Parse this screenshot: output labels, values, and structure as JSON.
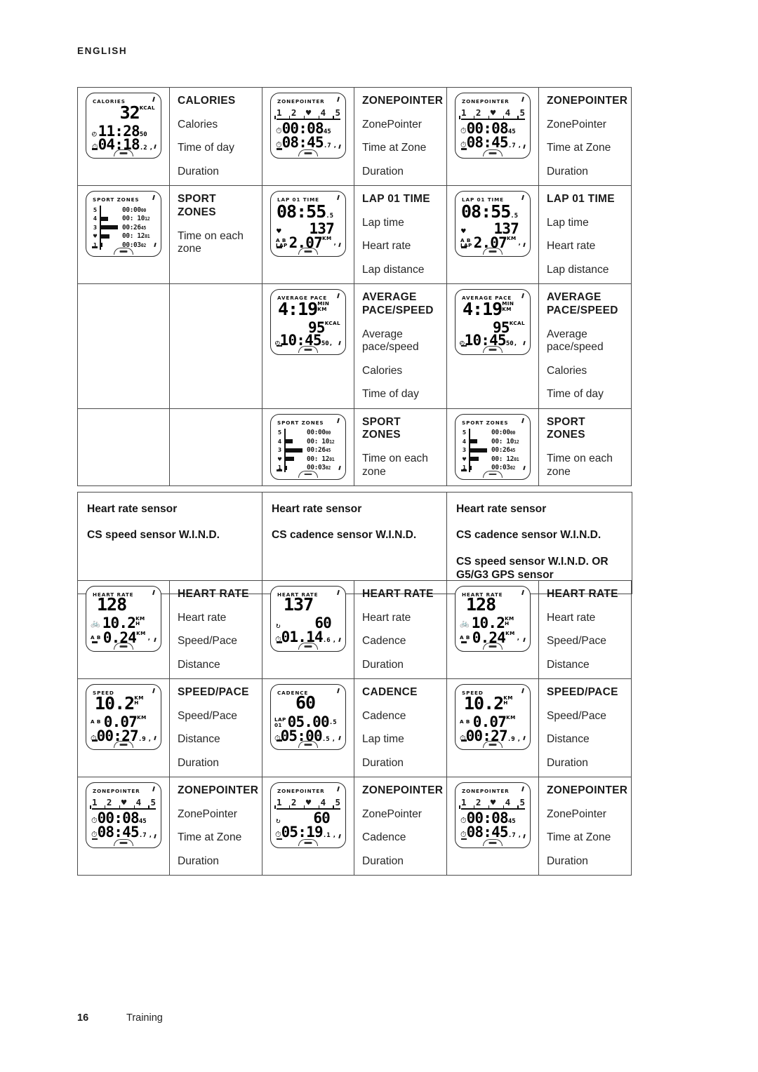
{
  "header": {
    "language": "ENGLISH"
  },
  "footer": {
    "page_number": "16",
    "section": "Training"
  },
  "displays": {
    "calories": {
      "screen_title": "CALORIES",
      "value": "32",
      "value_unit": "KCAL",
      "time_of_day": "11:28",
      "time_of_day_sub": "50",
      "duration": "04:18",
      "duration_sub": ".2"
    },
    "zonepointer": {
      "screen_title": "ZONEPOINTER",
      "zones": [
        "1",
        "2",
        "♥",
        "4",
        "5"
      ],
      "time_at_zone": "00:08",
      "time_at_zone_sub": "45",
      "duration": "08:45",
      "duration_sub": ".7"
    },
    "sport_zones": {
      "screen_title": "SPORT ZONES",
      "rows": [
        {
          "label": "5",
          "value": "00:00",
          "sub": "00",
          "bar": 2
        },
        {
          "label": "4",
          "value": "00: 10",
          "sub": "12",
          "bar": 12
        },
        {
          "label": "3",
          "value": "00:26",
          "sub": "45",
          "bar": 24
        },
        {
          "label": "♥",
          "value": "00: 12",
          "sub": "01",
          "bar": 13
        },
        {
          "label": "1",
          "value": "00:03",
          "sub": "02",
          "bar": 4
        }
      ]
    },
    "lap_01_time": {
      "screen_title": "LAP 01 TIME",
      "lap_time": "08:55",
      "lap_time_sub": ".5",
      "heart_rate": "137",
      "lap_distance": "2.07",
      "lap_distance_unit": "KM"
    },
    "average_pace": {
      "screen_title": "AVERAGE PACE",
      "pace": "4:19",
      "pace_unit": "MIN\nKM",
      "calories": "95",
      "calories_unit": "KCAL",
      "time_of_day": "10:45",
      "time_of_day_sub": "50"
    },
    "heart_rate_bike": {
      "screen_title": "HEART RATE",
      "heart_rate": "128",
      "speed": "10.2",
      "speed_unit": "KM\nH",
      "distance": "0.24",
      "distance_unit": "KM"
    },
    "heart_rate_cadence": {
      "screen_title": "HEART RATE",
      "heart_rate": "137",
      "cadence": "60",
      "duration": "01.14",
      "duration_sub": ".6"
    },
    "speed_pace": {
      "screen_title": "SPEED",
      "speed": "10.2",
      "speed_unit": "KM\nH",
      "distance": "0.07",
      "distance_unit": "KM",
      "duration": "00:27",
      "duration_sub": ".9"
    },
    "cadence": {
      "screen_title": "CADENCE",
      "cadence": "60",
      "lap_label": "LAP\n01",
      "lap_time": "05.00",
      "lap_time_sub": ".5",
      "duration": "05:00",
      "duration_sub": ".5"
    },
    "zonepointer_cadence": {
      "screen_title": "ZONEPOINTER",
      "zones": [
        "1",
        "2",
        "♥",
        "4",
        "5"
      ],
      "cadence": "60",
      "duration": "05:19",
      "duration_sub": ".1"
    }
  },
  "table_top": {
    "rows": [
      {
        "col1_heading": "CALORIES",
        "col1_items": [
          "Calories",
          "Time of day",
          "Duration"
        ],
        "col2_heading": "ZONEPOINTER",
        "col2_items": [
          "ZonePointer",
          "Time at Zone",
          "Duration"
        ],
        "col3_heading": "ZONEPOINTER",
        "col3_items": [
          "ZonePointer",
          "Time at Zone",
          "Duration"
        ]
      },
      {
        "col1_heading": "SPORT ZONES",
        "col1_items": [
          "Time on each zone"
        ],
        "col2_heading": "LAP 01 TIME",
        "col2_items": [
          "Lap time",
          "Heart rate",
          "Lap distance"
        ],
        "col3_heading": "LAP 01 TIME",
        "col3_items": [
          "Lap time",
          "Heart rate",
          "Lap distance"
        ]
      },
      {
        "col1_heading": "",
        "col1_items": [],
        "col2_heading": "AVERAGE\nPACE/SPEED",
        "col2_items": [
          "Average pace/speed",
          "Calories",
          "Time of day"
        ],
        "col3_heading": "AVERAGE\nPACE/SPEED",
        "col3_items": [
          "Average pace/speed",
          "Calories",
          "Time of day"
        ]
      },
      {
        "col1_heading": "",
        "col1_items": [],
        "col2_heading": "SPORT ZONES",
        "col2_items": [
          "Time on each zone"
        ],
        "col3_heading": "SPORT ZONES",
        "col3_items": [
          "Time on each zone"
        ]
      }
    ]
  },
  "table_sensors": {
    "col1": [
      "Heart rate sensor",
      "CS speed sensor W.I.N.D."
    ],
    "col2": [
      "Heart rate sensor",
      "CS cadence sensor W.I.N.D."
    ],
    "col3": [
      "Heart rate sensor",
      "CS cadence sensor W.I.N.D.",
      "CS speed sensor W.I.N.D. OR G5/G3 GPS sensor"
    ]
  },
  "table_bottom": {
    "rows": [
      {
        "col1_heading": "HEART RATE",
        "col1_items": [
          "Heart rate",
          "Speed/Pace",
          "Distance"
        ],
        "col2_heading": "HEART RATE",
        "col2_items": [
          "Heart rate",
          "Cadence",
          "Duration"
        ],
        "col3_heading": "HEART RATE",
        "col3_items": [
          "Heart rate",
          "Speed/Pace",
          "Distance"
        ]
      },
      {
        "col1_heading": "SPEED/PACE",
        "col1_items": [
          "Speed/Pace",
          "Distance",
          "Duration"
        ],
        "col2_heading": "CADENCE",
        "col2_items": [
          "Cadence",
          "Lap time",
          "Duration"
        ],
        "col3_heading": "SPEED/PACE",
        "col3_items": [
          "Speed/Pace",
          "Distance",
          "Duration"
        ]
      },
      {
        "col1_heading": "ZONEPOINTER",
        "col1_items": [
          "ZonePointer",
          "Time at Zone",
          "Duration"
        ],
        "col2_heading": "ZONEPOINTER",
        "col2_items": [
          "ZonePointer",
          "Cadence",
          "Duration"
        ],
        "col3_heading": "ZONEPOINTER",
        "col3_items": [
          "ZonePointer",
          "Time at Zone",
          "Duration"
        ]
      }
    ]
  }
}
